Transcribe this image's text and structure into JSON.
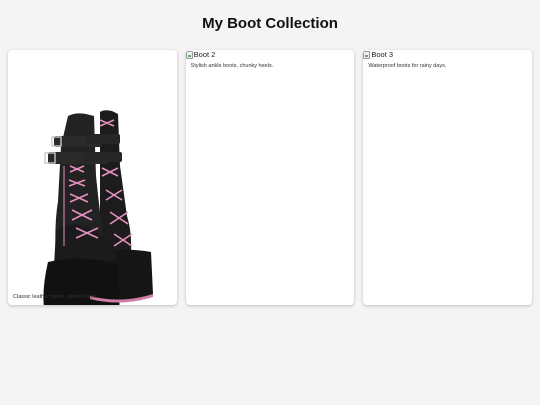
{
  "header": {
    "title": "My Boot Collection"
  },
  "cards": [
    {
      "image": "platform-boot-image",
      "caption": "Classic leather boots, winter hikes."
    },
    {
      "image_alt": "Boot 2",
      "caption": "Stylish ankle boots, chunky heels."
    },
    {
      "image_alt": "Boot 3",
      "caption": "Waterproof boots for rainy days."
    }
  ],
  "colors": {
    "background": "#f4f4f4",
    "card": "#ffffff",
    "boot": "#1a1a1a",
    "laces": "#e58fbf"
  }
}
